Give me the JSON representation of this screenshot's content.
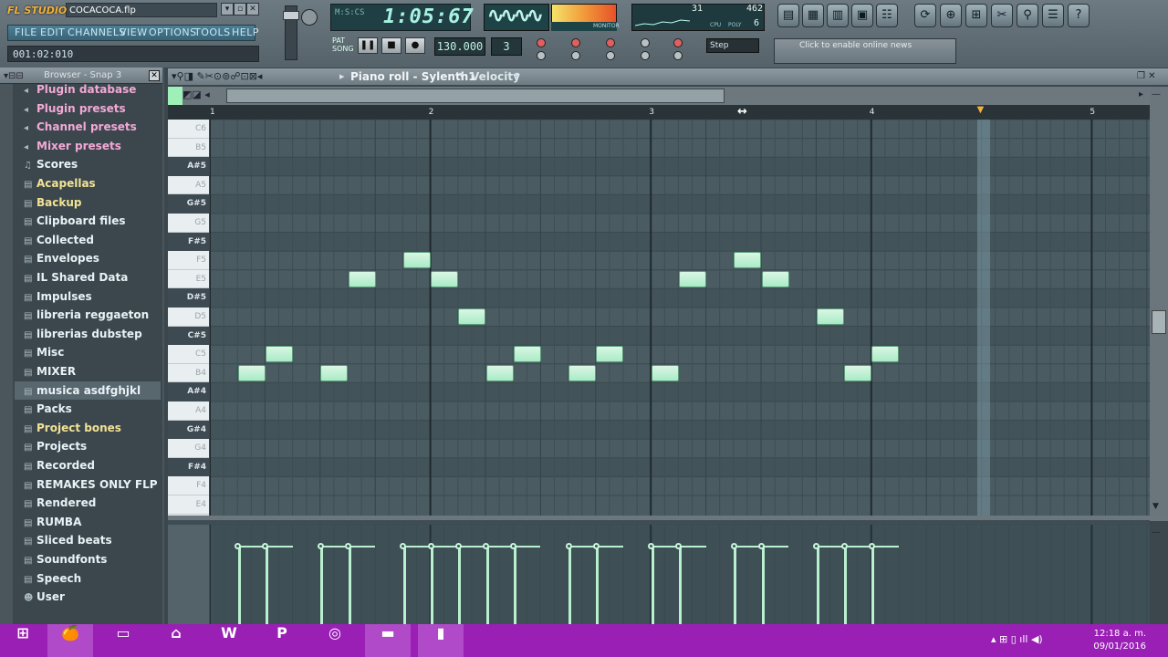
{
  "window": {
    "app_name": "FL STUDIO",
    "file_name": "COCACOCA.flp"
  },
  "menus": [
    "FILE",
    "EDIT",
    "CHANNELS",
    "VIEW",
    "OPTIONS",
    "TOOLS",
    "HELP"
  ],
  "hint_time": "001:02:010",
  "transport": {
    "song_time": "1:05:67",
    "time_small": "M:S:CS",
    "tempo": "130.000",
    "pattern": "3",
    "mode_label_pat": "PAT",
    "mode_label_song": "SONG",
    "snap": "Step"
  },
  "monitor": {
    "cpu": "31",
    "ram": "462",
    "poly": "6",
    "cpu_label": "CPU",
    "poly_label": "POLY",
    "monitor_label": "MONITOR"
  },
  "news": {
    "text": "Click to enable online news"
  },
  "browser": {
    "title": "Browser - Snap 3",
    "items": [
      {
        "label": "Plugin database",
        "style": "pink",
        "icon": "plug-icon"
      },
      {
        "label": "Plugin presets",
        "style": "pink",
        "icon": "plug-icon"
      },
      {
        "label": "Channel presets",
        "style": "pink",
        "icon": "plug-icon"
      },
      {
        "label": "Mixer presets",
        "style": "pink",
        "icon": "plug-icon"
      },
      {
        "label": "Scores",
        "style": "white",
        "icon": "note-icon"
      },
      {
        "label": "Acapellas",
        "style": "yellow",
        "icon": "folder-icon"
      },
      {
        "label": "Backup",
        "style": "yellow",
        "icon": "folder-icon"
      },
      {
        "label": "Clipboard files",
        "style": "white",
        "icon": "folder-icon"
      },
      {
        "label": "Collected",
        "style": "white",
        "icon": "folder-icon"
      },
      {
        "label": "Envelopes",
        "style": "white",
        "icon": "folder-icon"
      },
      {
        "label": "IL Shared Data",
        "style": "white",
        "icon": "folder-icon"
      },
      {
        "label": "Impulses",
        "style": "white",
        "icon": "folder-icon"
      },
      {
        "label": "libreria reggaeton",
        "style": "white",
        "icon": "folder-icon"
      },
      {
        "label": "librerias dubstep",
        "style": "white",
        "icon": "folder-icon"
      },
      {
        "label": "Misc",
        "style": "white",
        "icon": "folder-icon"
      },
      {
        "label": "MIXER",
        "style": "white",
        "icon": "folder-icon"
      },
      {
        "label": "musica asdfghjkl",
        "style": "white",
        "icon": "folder-icon",
        "selected": true
      },
      {
        "label": "Packs",
        "style": "white",
        "icon": "folder-icon"
      },
      {
        "label": "Project bones",
        "style": "yellow",
        "icon": "folder-icon"
      },
      {
        "label": "Projects",
        "style": "white",
        "icon": "folder-icon"
      },
      {
        "label": "Recorded",
        "style": "white",
        "icon": "folder-icon"
      },
      {
        "label": "REMAKES ONLY FLP",
        "style": "white",
        "icon": "folder-icon"
      },
      {
        "label": "Rendered",
        "style": "white",
        "icon": "folder-icon"
      },
      {
        "label": "RUMBA",
        "style": "white",
        "icon": "folder-icon"
      },
      {
        "label": "Sliced beats",
        "style": "white",
        "icon": "folder-icon"
      },
      {
        "label": "Soundfonts",
        "style": "white",
        "icon": "folder-icon"
      },
      {
        "label": "Speech",
        "style": "white",
        "icon": "folder-icon"
      },
      {
        "label": "User",
        "style": "white",
        "icon": "user-icon"
      }
    ]
  },
  "piano_roll": {
    "title": "Piano roll - Sylenth1",
    "target": "Velocity",
    "bars": [
      "1",
      "2",
      "3",
      "4",
      "5"
    ],
    "playhead_bar": 4.5,
    "keys": [
      {
        "label": "C6",
        "black": false
      },
      {
        "label": "B5",
        "black": false
      },
      {
        "label": "A#5",
        "black": true
      },
      {
        "label": "A5",
        "black": false
      },
      {
        "label": "G#5",
        "black": true
      },
      {
        "label": "G5",
        "black": false
      },
      {
        "label": "F#5",
        "black": true
      },
      {
        "label": "F5",
        "black": false
      },
      {
        "label": "E5",
        "black": false
      },
      {
        "label": "D#5",
        "black": true
      },
      {
        "label": "D5",
        "black": false
      },
      {
        "label": "C#5",
        "black": true
      },
      {
        "label": "C5",
        "black": false
      },
      {
        "label": "B4",
        "black": false
      },
      {
        "label": "A#4",
        "black": true
      },
      {
        "label": "A4",
        "black": false
      },
      {
        "label": "G#4",
        "black": true
      },
      {
        "label": "G4",
        "black": false
      },
      {
        "label": "F#4",
        "black": true
      },
      {
        "label": "F4",
        "black": false
      },
      {
        "label": "E4",
        "black": false
      }
    ],
    "notes": [
      {
        "pitch": "B4",
        "start_step": 1
      },
      {
        "pitch": "C5",
        "start_step": 2
      },
      {
        "pitch": "B4",
        "start_step": 4
      },
      {
        "pitch": "E5",
        "start_step": 5
      },
      {
        "pitch": "F5",
        "start_step": 7
      },
      {
        "pitch": "E5",
        "start_step": 8
      },
      {
        "pitch": "D5",
        "start_step": 9
      },
      {
        "pitch": "B4",
        "start_step": 10
      },
      {
        "pitch": "C5",
        "start_step": 11
      },
      {
        "pitch": "B4",
        "start_step": 13
      },
      {
        "pitch": "C5",
        "start_step": 14
      },
      {
        "pitch": "B4",
        "start_step": 16
      },
      {
        "pitch": "E5",
        "start_step": 17
      },
      {
        "pitch": "F5",
        "start_step": 19
      },
      {
        "pitch": "E5",
        "start_step": 20
      },
      {
        "pitch": "D5",
        "start_step": 22
      },
      {
        "pitch": "B4",
        "start_step": 23
      },
      {
        "pitch": "C5",
        "start_step": 24
      }
    ]
  },
  "taskbar": {
    "time": "12:18 a. m.",
    "date": "09/01/2016"
  },
  "colors": {
    "note_fill": "#b9f0d0",
    "grid_bg": "#4a5b62",
    "taskbar": "#9a1fb5",
    "accent_pink": "#f3a8d6",
    "accent_yellow": "#f2e294"
  }
}
